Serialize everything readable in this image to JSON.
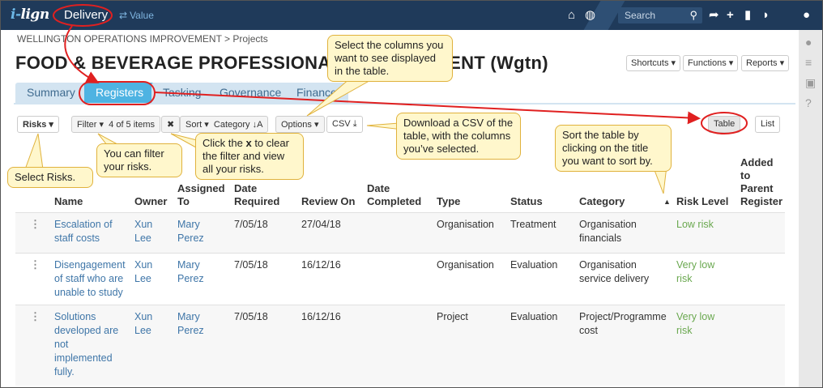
{
  "topbar": {
    "logo": "i-lign",
    "delivery": "Delivery",
    "value": "Value",
    "search_placeholder": "Search"
  },
  "breadcrumb": "WELLINGTON OPERATIONS IMPROVEMENT > Projects",
  "page_title": "FOOD & BEVERAGE PROFESSIONAL DEVELOPMENT (Wgtn)",
  "header_buttons": {
    "shortcuts": "Shortcuts ▾",
    "functions": "Functions ▾",
    "reports": "Reports ▾"
  },
  "tabs": [
    "Summary",
    "Registers",
    "Tasking",
    "Governance",
    "Finance"
  ],
  "toolbar": {
    "risks": "Risks ▾",
    "filter": "Filter ▾",
    "filter_count": "4 of 5 items",
    "clear": "✖",
    "sort": "Sort ▾",
    "sort_value": "Category ↓A",
    "options": "Options ▾",
    "csv": "CSV",
    "table": "Table",
    "list": "List"
  },
  "columns": {
    "name": "Name",
    "owner": "Owner",
    "assigned_1": "Assigned",
    "assigned_2": "To",
    "date_required_1": "Date",
    "date_required_2": "Required",
    "review_on": "Review On",
    "date_completed_1": "Date",
    "date_completed_2": "Completed",
    "type": "Type",
    "status": "Status",
    "category": "Category",
    "risk_level": "Risk Level",
    "added_1": "Added",
    "added_2": "to",
    "added_3": "Parent",
    "added_4": "Register"
  },
  "rows": [
    {
      "name": "Escalation of staff costs",
      "owner": "Xun Lee",
      "assigned": "Mary Perez",
      "date_required": "7/05/18",
      "review_on": "27/04/18",
      "type": "Organisation",
      "status": "Treatment",
      "category": "Organisation financials",
      "risk_level": "Low risk"
    },
    {
      "name": "Disengagement of staff who are unable to study",
      "owner": "Xun Lee",
      "assigned": "Mary Perez",
      "date_required": "7/05/18",
      "review_on": "16/12/16",
      "type": "Organisation",
      "status": "Evaluation",
      "category": "Organisation service delivery",
      "risk_level": "Very low risk"
    },
    {
      "name": "Solutions developed are not implemented fully.",
      "owner": "Xun Lee",
      "assigned": "Mary Perez",
      "date_required": "7/05/18",
      "review_on": "16/12/16",
      "type": "Project",
      "status": "Evaluation",
      "category": "Project/Programme cost",
      "risk_level": "Very low risk"
    }
  ],
  "callouts": {
    "columns": "Select the columns you want to see displayed in the table.",
    "csv": "Download a CSV of the table, with the columns you’ve selected.",
    "sort": "Sort the table by clicking on the title you want to sort by.",
    "filter": "You can filter your risks.",
    "clear_pre": "Click the ",
    "clear_x": "x",
    "clear_post": " to clear the filter and view all your risks.",
    "risks": "Select Risks."
  },
  "colors": {
    "topbar": "#1f3a5a",
    "tab_active": "#4eb3e2",
    "annotation": "#e02020",
    "callout_bg": "#fff7cc",
    "risk_green": "#6aa84f"
  }
}
